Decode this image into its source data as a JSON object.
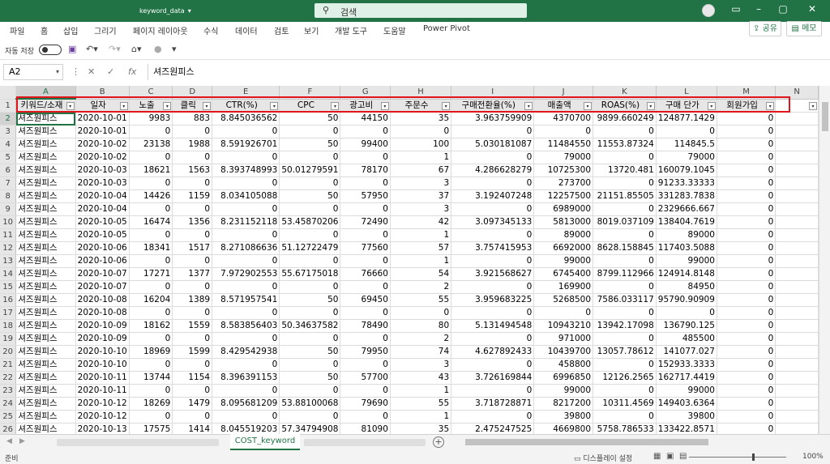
{
  "titlebar": {
    "file_name": "keyword_data",
    "file_caret": "▾",
    "search_placeholder": "검색"
  },
  "menu": [
    "파일",
    "홈",
    "삽입",
    "그리기",
    "페이지 레이아웃",
    "수식",
    "데이터",
    "검토",
    "보기",
    "개발 도구",
    "도움말",
    "Power Pivot"
  ],
  "share_label": "공유",
  "memo_label": "메모",
  "autosave_label": "자동 저장",
  "name_box": "A2",
  "formula_value": "셔즈원피스",
  "col_letters": [
    "A",
    "B",
    "C",
    "D",
    "E",
    "F",
    "G",
    "H",
    "I",
    "J",
    "K",
    "L",
    "M",
    "N"
  ],
  "headers": [
    "키워드/소재",
    "일자",
    "노출",
    "클릭",
    "CTR(%)",
    "CPC",
    "광고비",
    "주문수",
    "구매전환율(%)",
    "매출액",
    "ROAS(%)",
    "구매 단가",
    "회원가입"
  ],
  "rows": [
    [
      "셔즈원피스",
      "2020-10-01",
      "9983",
      "883",
      "8.845036562",
      "50",
      "44150",
      "35",
      "3.963759909",
      "4370700",
      "9899.660249",
      "124877.1429",
      "0"
    ],
    [
      "셔즈원피스",
      "2020-10-01",
      "0",
      "0",
      "0",
      "0",
      "0",
      "0",
      "0",
      "0",
      "0",
      "0",
      "0"
    ],
    [
      "셔즈원피스",
      "2020-10-02",
      "23138",
      "1988",
      "8.591926701",
      "50",
      "99400",
      "100",
      "5.030181087",
      "11484550",
      "11553.87324",
      "114845.5",
      "0"
    ],
    [
      "셔즈원피스",
      "2020-10-02",
      "0",
      "0",
      "0",
      "0",
      "0",
      "1",
      "0",
      "79000",
      "0",
      "79000",
      "0"
    ],
    [
      "셔즈원피스",
      "2020-10-03",
      "18621",
      "1563",
      "8.393748993",
      "50.01279591",
      "78170",
      "67",
      "4.286628279",
      "10725300",
      "13720.481",
      "160079.1045",
      "0"
    ],
    [
      "셔즈원피스",
      "2020-10-03",
      "0",
      "0",
      "0",
      "0",
      "0",
      "3",
      "0",
      "273700",
      "0",
      "91233.33333",
      "0"
    ],
    [
      "셔즈원피스",
      "2020-10-04",
      "14426",
      "1159",
      "8.034105088",
      "50",
      "57950",
      "37",
      "3.192407248",
      "12257500",
      "21151.85505",
      "331283.7838",
      "0"
    ],
    [
      "셔즈원피스",
      "2020-10-04",
      "0",
      "0",
      "0",
      "0",
      "0",
      "3",
      "0",
      "6989000",
      "0",
      "2329666.667",
      "0"
    ],
    [
      "셔즈원피스",
      "2020-10-05",
      "16474",
      "1356",
      "8.231152118",
      "53.45870206",
      "72490",
      "42",
      "3.097345133",
      "5813000",
      "8019.037109",
      "138404.7619",
      "0"
    ],
    [
      "셔즈원피스",
      "2020-10-05",
      "0",
      "0",
      "0",
      "0",
      "0",
      "1",
      "0",
      "89000",
      "0",
      "89000",
      "0"
    ],
    [
      "셔즈원피스",
      "2020-10-06",
      "18341",
      "1517",
      "8.271086636",
      "51.12722479",
      "77560",
      "57",
      "3.757415953",
      "6692000",
      "8628.158845",
      "117403.5088",
      "0"
    ],
    [
      "셔즈원피스",
      "2020-10-06",
      "0",
      "0",
      "0",
      "0",
      "0",
      "1",
      "0",
      "99000",
      "0",
      "99000",
      "0"
    ],
    [
      "셔즈원피스",
      "2020-10-07",
      "17271",
      "1377",
      "7.972902553",
      "55.67175018",
      "76660",
      "54",
      "3.921568627",
      "6745400",
      "8799.112966",
      "124914.8148",
      "0"
    ],
    [
      "셔즈원피스",
      "2020-10-07",
      "0",
      "0",
      "0",
      "0",
      "0",
      "2",
      "0",
      "169900",
      "0",
      "84950",
      "0"
    ],
    [
      "셔즈원피스",
      "2020-10-08",
      "16204",
      "1389",
      "8.571957541",
      "50",
      "69450",
      "55",
      "3.959683225",
      "5268500",
      "7586.033117",
      "95790.90909",
      "0"
    ],
    [
      "셔즈원피스",
      "2020-10-08",
      "0",
      "0",
      "0",
      "0",
      "0",
      "0",
      "0",
      "0",
      "0",
      "0",
      "0"
    ],
    [
      "셔즈원피스",
      "2020-10-09",
      "18162",
      "1559",
      "8.583856403",
      "50.34637582",
      "78490",
      "80",
      "5.131494548",
      "10943210",
      "13942.17098",
      "136790.125",
      "0"
    ],
    [
      "셔즈원피스",
      "2020-10-09",
      "0",
      "0",
      "0",
      "0",
      "0",
      "2",
      "0",
      "971000",
      "0",
      "485500",
      "0"
    ],
    [
      "셔즈원피스",
      "2020-10-10",
      "18969",
      "1599",
      "8.429542938",
      "50",
      "79950",
      "74",
      "4.627892433",
      "10439700",
      "13057.78612",
      "141077.027",
      "0"
    ],
    [
      "셔즈원피스",
      "2020-10-10",
      "0",
      "0",
      "0",
      "0",
      "0",
      "3",
      "0",
      "458800",
      "0",
      "152933.3333",
      "0"
    ],
    [
      "셔즈원피스",
      "2020-10-11",
      "13744",
      "1154",
      "8.396391153",
      "50",
      "57700",
      "43",
      "3.726169844",
      "6996850",
      "12126.2565",
      "162717.4419",
      "0"
    ],
    [
      "셔즈원피스",
      "2020-10-11",
      "0",
      "0",
      "0",
      "0",
      "0",
      "1",
      "0",
      "99000",
      "0",
      "99000",
      "0"
    ],
    [
      "셔즈원피스",
      "2020-10-12",
      "18269",
      "1479",
      "8.095681209",
      "53.88100068",
      "79690",
      "55",
      "3.718728871",
      "8217200",
      "10311.4569",
      "149403.6364",
      "0"
    ],
    [
      "셔즈원피스",
      "2020-10-12",
      "0",
      "0",
      "0",
      "0",
      "0",
      "1",
      "0",
      "39800",
      "0",
      "39800",
      "0"
    ],
    [
      "셔즈원피스",
      "2020-10-13",
      "17575",
      "1414",
      "8.045519203",
      "57.34794908",
      "81090",
      "35",
      "2.475247525",
      "4669800",
      "5758.786533",
      "133422.8571",
      "0"
    ]
  ],
  "sheet_tab": "COST_keyword",
  "status": {
    "ready": "준비",
    "display_settings": "디스플레이 설정",
    "zoom": "100%"
  }
}
